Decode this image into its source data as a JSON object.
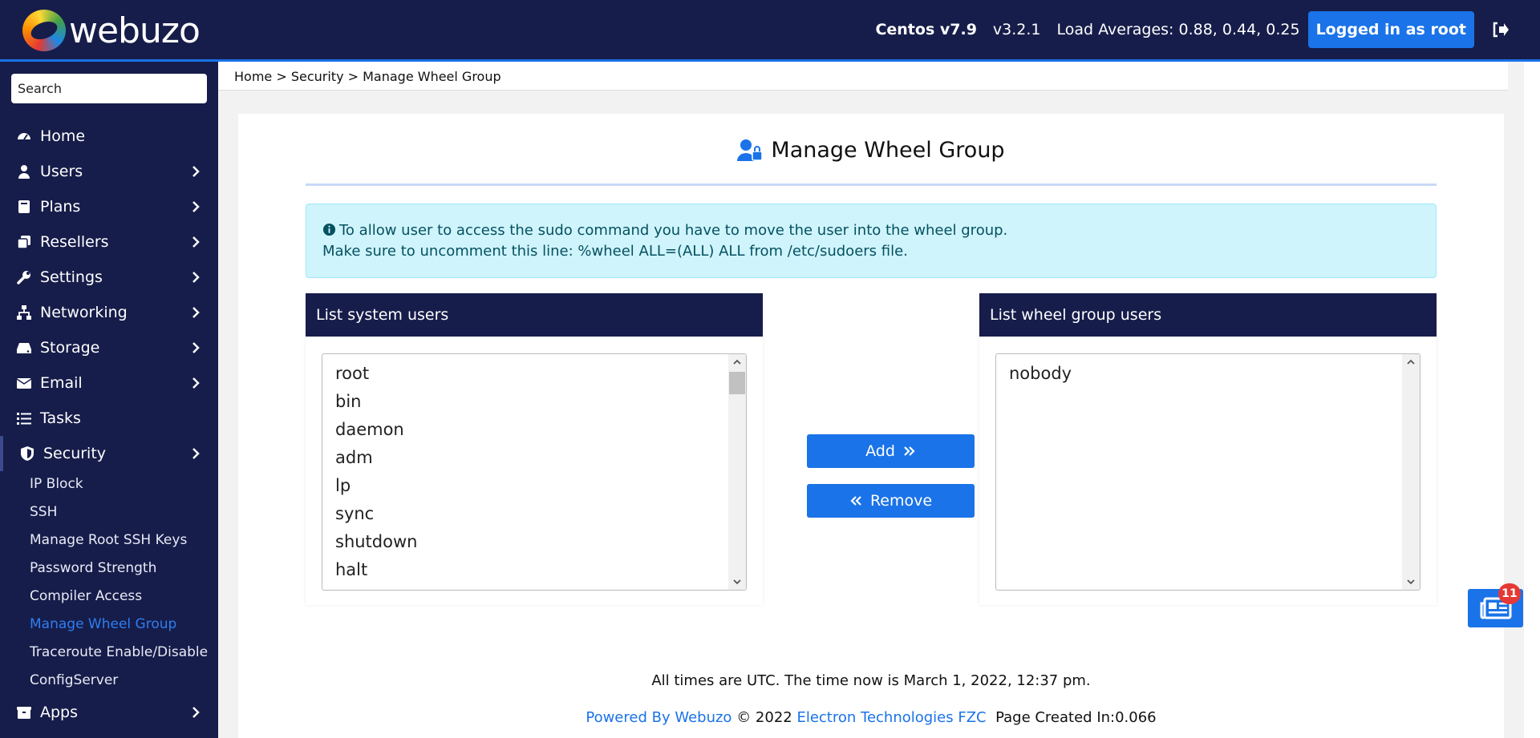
{
  "header": {
    "logo_text": "webuzo",
    "os": "Centos v7.9",
    "version": "v3.2.1",
    "load_averages": "Load Averages: 0.88, 0.44, 0.25",
    "login_label": "Logged in as root"
  },
  "sidebar": {
    "search_placeholder": "Search",
    "items": [
      {
        "label": "Home",
        "icon": "dashboard-icon"
      },
      {
        "label": "Users",
        "icon": "user-icon"
      },
      {
        "label": "Plans",
        "icon": "book-icon"
      },
      {
        "label": "Resellers",
        "icon": "clone-icon"
      },
      {
        "label": "Settings",
        "icon": "wrench-icon"
      },
      {
        "label": "Networking",
        "icon": "network-icon"
      },
      {
        "label": "Storage",
        "icon": "hdd-icon"
      },
      {
        "label": "Email",
        "icon": "envelope-icon"
      },
      {
        "label": "Tasks",
        "icon": "list-icon"
      },
      {
        "label": "Security",
        "icon": "shield-icon"
      },
      {
        "label": "Apps",
        "icon": "box-icon"
      }
    ],
    "security_sub": [
      "IP Block",
      "SSH",
      "Manage Root SSH Keys",
      "Password Strength",
      "Compiler Access",
      "Manage Wheel Group",
      "Traceroute Enable/Disable",
      "ConfigServer"
    ]
  },
  "breadcrumb": "Home > Security > Manage Wheel Group",
  "page": {
    "title": "Manage Wheel Group",
    "alert_line1": "To allow user to access the sudo command you have to move the user into the wheel group.",
    "alert_line2": "Make sure to uncomment this line: %wheel ALL=(ALL) ALL from /etc/sudoers file.",
    "system_users_title": "List system users",
    "system_users": [
      "root",
      "bin",
      "daemon",
      "adm",
      "lp",
      "sync",
      "shutdown",
      "halt"
    ],
    "wheel_users_title": "List wheel group users",
    "wheel_users": [
      "nobody"
    ],
    "add_label": "Add",
    "remove_label": "Remove"
  },
  "footer": {
    "time_note": "All times are UTC. The time now is March 1, 2022, 12:37 pm.",
    "powered_by": "Powered By Webuzo",
    "copyright": "© 2022",
    "company": "Electron Technologies FZC",
    "page_created": "Page Created In:0.066"
  },
  "news_badge": "11",
  "colors": {
    "navy": "#161d4a",
    "accent": "#1a73e8",
    "alert_bg": "#cff4fc"
  }
}
